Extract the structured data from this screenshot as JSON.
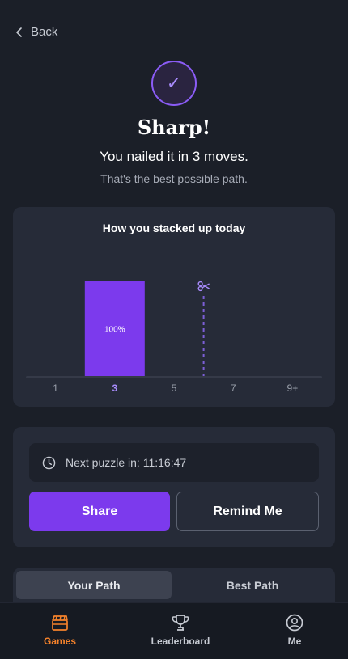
{
  "nav": {
    "back_label": "Back"
  },
  "result": {
    "check_glyph": "✓",
    "title": "Sharp!",
    "subtitle": "You nailed it in 3 moves.",
    "note": "That's the best possible path."
  },
  "chart_title": "How you stacked up today",
  "chart_data": {
    "type": "bar",
    "categories": [
      "1",
      "3",
      "5",
      "7",
      "9+"
    ],
    "values": [
      0,
      100,
      0,
      0,
      0
    ],
    "bar_labels": [
      "",
      "100%",
      "",
      "",
      ""
    ],
    "highlight_category": "3",
    "marker_between": [
      "5",
      "7"
    ],
    "marker_icon": "scissors-icon",
    "colors": {
      "bar": "#7c3aed",
      "highlight_tick": "#a78bfa",
      "marker": "#7c5fd6"
    }
  },
  "next_puzzle": {
    "label": "Next puzzle in: 11:16:47"
  },
  "actions": {
    "share_label": "Share",
    "remind_label": "Remind Me"
  },
  "tabs": [
    {
      "label": "Your Path",
      "selected": true
    },
    {
      "label": "Best Path",
      "selected": false
    }
  ],
  "bottom_nav": [
    {
      "label": "Games",
      "icon": "clapperboard-icon",
      "active": true
    },
    {
      "label": "Leaderboard",
      "icon": "trophy-icon",
      "active": false
    },
    {
      "label": "Me",
      "icon": "user-circle-icon",
      "active": false
    }
  ],
  "colors": {
    "accent": "#7c3aed",
    "active_nav": "#f5822b",
    "background": "#1b1f28"
  }
}
